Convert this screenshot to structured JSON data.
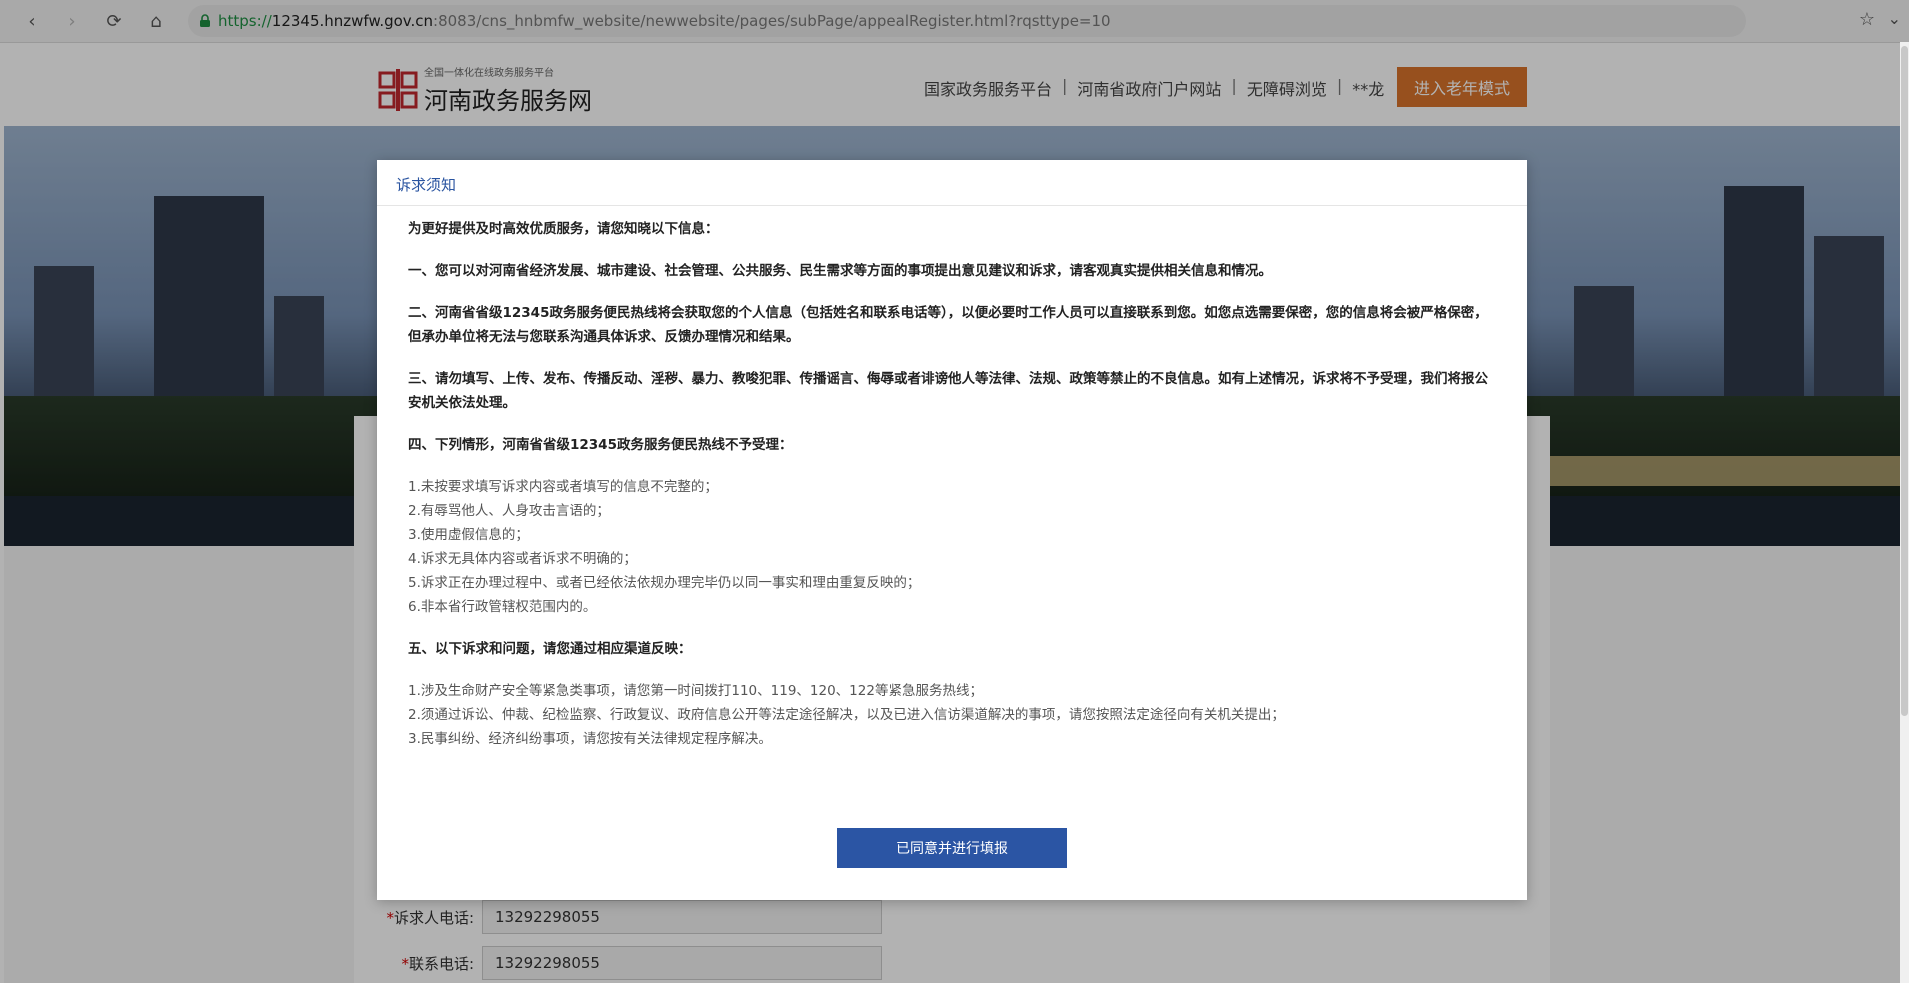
{
  "browser": {
    "url_scheme": "https://",
    "url_host": "12345.hnzwfw.gov.cn",
    "url_rest": ":8083/cns_hnbmfw_website/newwebsite/pages/subPage/appealRegister.html?rqsttype=10"
  },
  "header": {
    "logo_sub": "全国一体化在线政务服务平台",
    "logo_main": "河南政务服务网",
    "nav": [
      "国家政务服务平台",
      "河南省政府门户网站",
      "无障碍浏览"
    ],
    "nav_sep": "|",
    "user": "**龙",
    "elder_mode": "进入老年模式"
  },
  "form": {
    "phone_label": "诉求人电话:",
    "phone_value": "13292298055",
    "contact_label": "联系电话:",
    "contact_value": "13292298055"
  },
  "modal": {
    "title": "诉求须知",
    "intro": "为更好提供及时高效优质服务，请您知晓以下信息：",
    "p1": "一、您可以对河南省经济发展、城市建设、社会管理、公共服务、民生需求等方面的事项提出意见建议和诉求，请客观真实提供相关信息和情况。",
    "p2": "二、河南省省级12345政务服务便民热线将会获取您的个人信息（包括姓名和联系电话等），以便必要时工作人员可以直接联系到您。如您点选需要保密，您的信息将会被严格保密，但承办单位将无法与您联系沟通具体诉求、反馈办理情况和结果。",
    "p3": "三、请勿填写、上传、发布、传播反动、淫秽、暴力、教唆犯罪、传播谣言、侮辱或者诽谤他人等法律、法规、政策等禁止的不良信息。如有上述情况，诉求将不予受理，我们将报公安机关依法处理。",
    "p4": "四、下列情形，河南省省级12345政务服务便民热线不予受理：",
    "list4": [
      "1.未按要求填写诉求内容或者填写的信息不完整的；",
      "2.有辱骂他人、人身攻击言语的；",
      "3.使用虚假信息的；",
      "4.诉求无具体内容或者诉求不明确的；",
      "5.诉求正在办理过程中、或者已经依法依规办理完毕仍以同一事实和理由重复反映的；",
      "6.非本省行政管辖权范围内的。"
    ],
    "p5": "五、以下诉求和问题，请您通过相应渠道反映：",
    "list5": [
      "1.涉及生命财产安全等紧急类事项，请您第一时间拨打110、119、120、122等紧急服务热线；",
      "2.须通过诉讼、仲裁、纪检监察、行政复议、政府信息公开等法定途径解决，以及已进入信访渠道解决的事项，请您按照法定途径向有关机关提出；",
      "3.民事纠纷、经济纠纷事项，请您按有关法律规定程序解决。"
    ],
    "agree_button": "已同意并进行填报"
  },
  "colors": {
    "accent_blue": "#2b55a4",
    "elder_orange": "#d9732b",
    "required_red": "#d10000"
  }
}
